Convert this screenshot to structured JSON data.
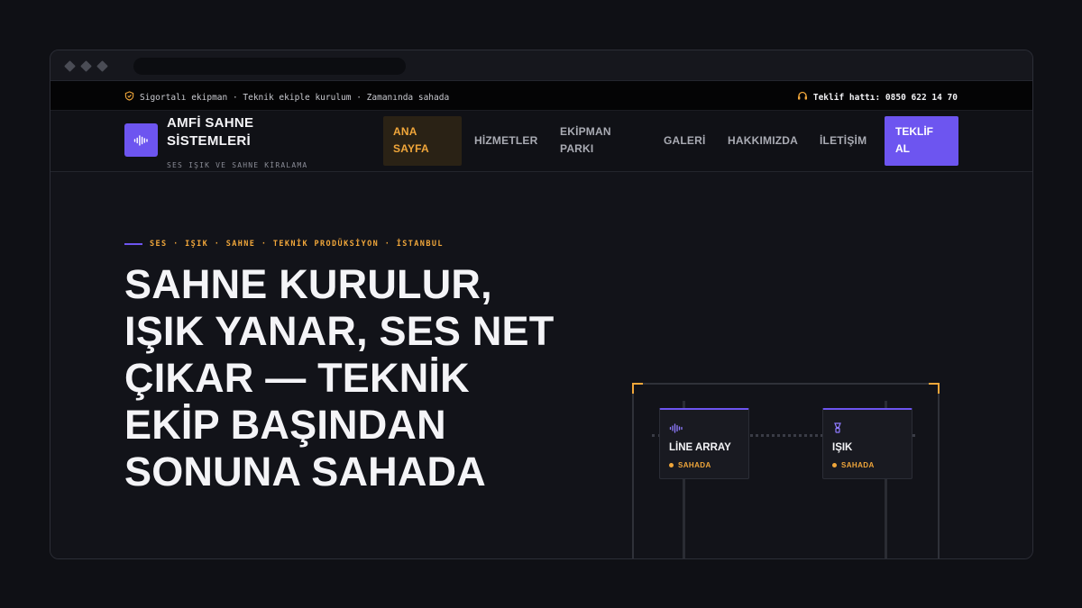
{
  "topbar": {
    "features": "Sigortalı ekipman · Teknik ekiple kurulum · Zamanında sahada",
    "hotline": "Teklif hattı: 0850 622 14 70"
  },
  "brand": {
    "name": "AMFİ SAHNE SİSTEMLERİ",
    "tagline": "SES IŞIK VE SAHNE KİRALAMA"
  },
  "nav": {
    "items": [
      {
        "label": "ANA SAYFA",
        "active": true
      },
      {
        "label": "HİZMETLER"
      },
      {
        "label": "EKİPMAN PARKI"
      },
      {
        "label": "GALERİ"
      },
      {
        "label": "HAKKIMIZDA"
      },
      {
        "label": "İLETİŞİM"
      }
    ],
    "cta": "TEKLİF AL"
  },
  "hero": {
    "eyebrow": "SES · IŞIK · SAHNE · TEKNİK PRODÜKSİYON · İSTANBUL",
    "headline": "SAHNE KURULUR, IŞIK YANAR, SES NET ÇIKAR — TEKNİK EKİP BAŞINDAN SONUNA SAHADA"
  },
  "stage": {
    "cards": [
      {
        "label": "LİNE ARRAY",
        "status": "SAHADA",
        "icon": "waveform-icon"
      },
      {
        "label": "IŞIK",
        "status": "SAHADA",
        "icon": "stage-light-icon"
      }
    ]
  },
  "colors": {
    "accent_purple": "#6d55f0",
    "accent_amber": "#f0a63a",
    "background": "#121319"
  }
}
